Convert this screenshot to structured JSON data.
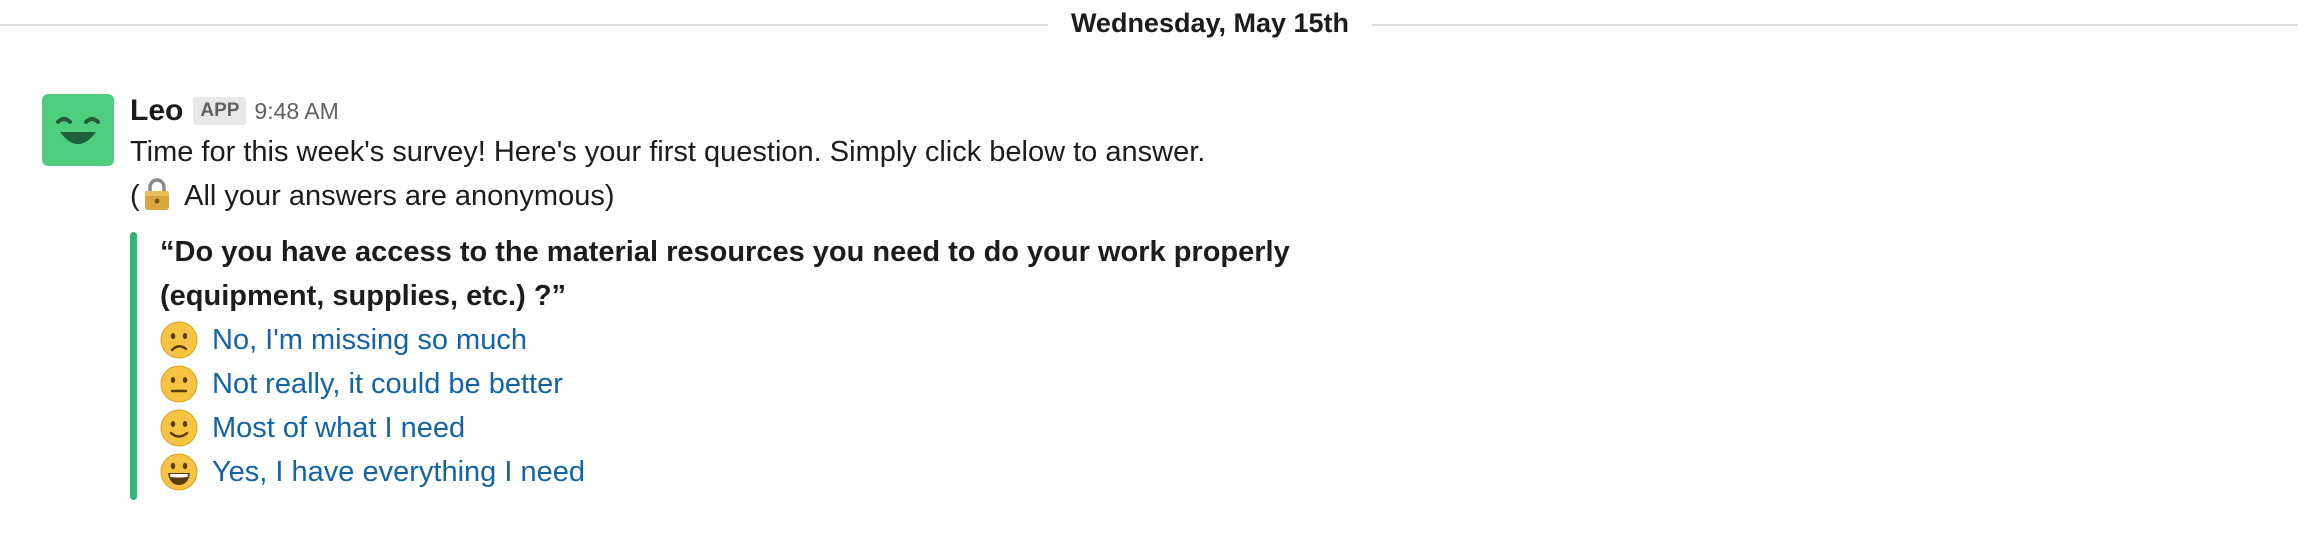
{
  "divider": {
    "date": "Wednesday, May 15th"
  },
  "message": {
    "sender": "Leo",
    "badge": "APP",
    "time": "9:48 AM",
    "avatar_icon": "smiling-face-avatar-icon",
    "avatar_color": "#4fce7f",
    "text_line1": "Time for this week's survey! Here's your first question. Simply click below to answer.",
    "text_line2_prefix": "(",
    "text_line2_icon": "lock-icon",
    "text_line2_rest": " All your answers are anonymous)"
  },
  "attachment": {
    "accent_color": "#2eb67d",
    "question_line1": "“Do you have access to the material resources you need to do your work properly",
    "question_line2": "(equipment, supplies, etc.) ?”",
    "options": [
      {
        "label": "No, I'm missing so much",
        "icon": "slightly-frowning-face-icon"
      },
      {
        "label": "Not really, it could be better",
        "icon": "neutral-face-icon"
      },
      {
        "label": "Most of what I need",
        "icon": "slightly-smiling-face-icon"
      },
      {
        "label": "Yes, I have everything I need",
        "icon": "grinning-face-icon"
      }
    ]
  },
  "colors": {
    "link": "#1264a3",
    "text": "#1d1c1d",
    "muted": "#616061"
  }
}
